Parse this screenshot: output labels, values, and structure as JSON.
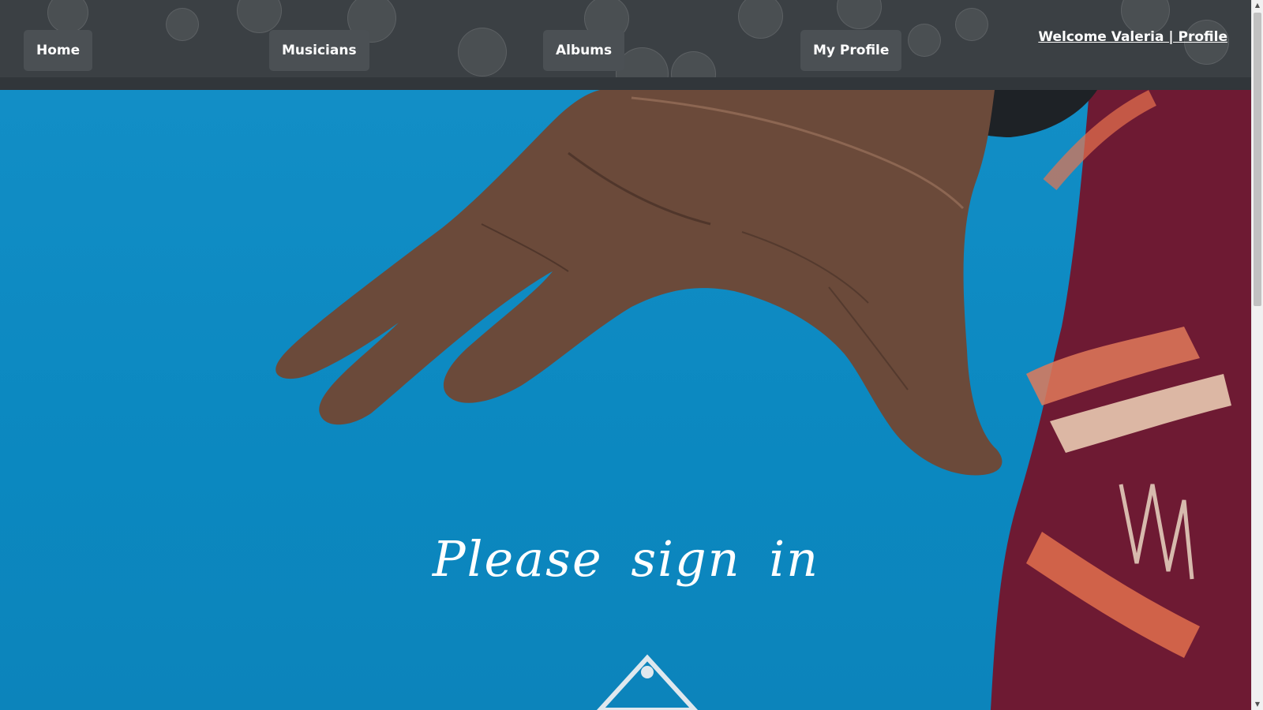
{
  "nav": {
    "home_label": "Home",
    "musicians_label": "Musicians",
    "albums_label": "Albums",
    "my_profile_label": "My Profile",
    "welcome_text": "Welcome Valeria | Profile"
  },
  "hero": {
    "title": "Please sign in",
    "image_description_icon": "hand-photo"
  },
  "colors": {
    "navbar_bg": "#3b4044",
    "nav_button_bg": "#4b5054",
    "hero_sky": "#0b88c0",
    "shirt": "#6e1a33",
    "text": "#ffffff"
  },
  "scrollbar": {
    "up_icon": "scroll-up-arrow-icon",
    "down_icon": "scroll-down-arrow-icon"
  }
}
